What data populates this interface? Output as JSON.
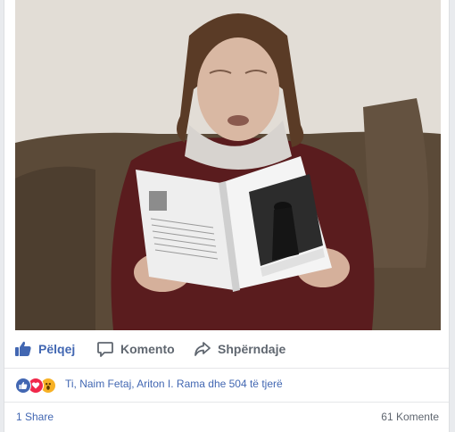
{
  "post": {
    "photo_alt": "",
    "actions": {
      "like_label": "Pëlqej",
      "comment_label": "Komento",
      "share_label": "Shpërndaje"
    },
    "reactions": {
      "icons": [
        "like-reaction",
        "love-reaction",
        "wow-reaction"
      ],
      "summary_text": "Ti, Naim Fetaj, Ariton I. Rama dhe 504 të tjerë"
    },
    "footer": {
      "shares_text": "1 Share",
      "comments_text": "61 Komente"
    },
    "colors": {
      "accent": "#4267b2",
      "muted": "#606770",
      "love": "#f0284a",
      "wow": "#f7b125"
    }
  }
}
